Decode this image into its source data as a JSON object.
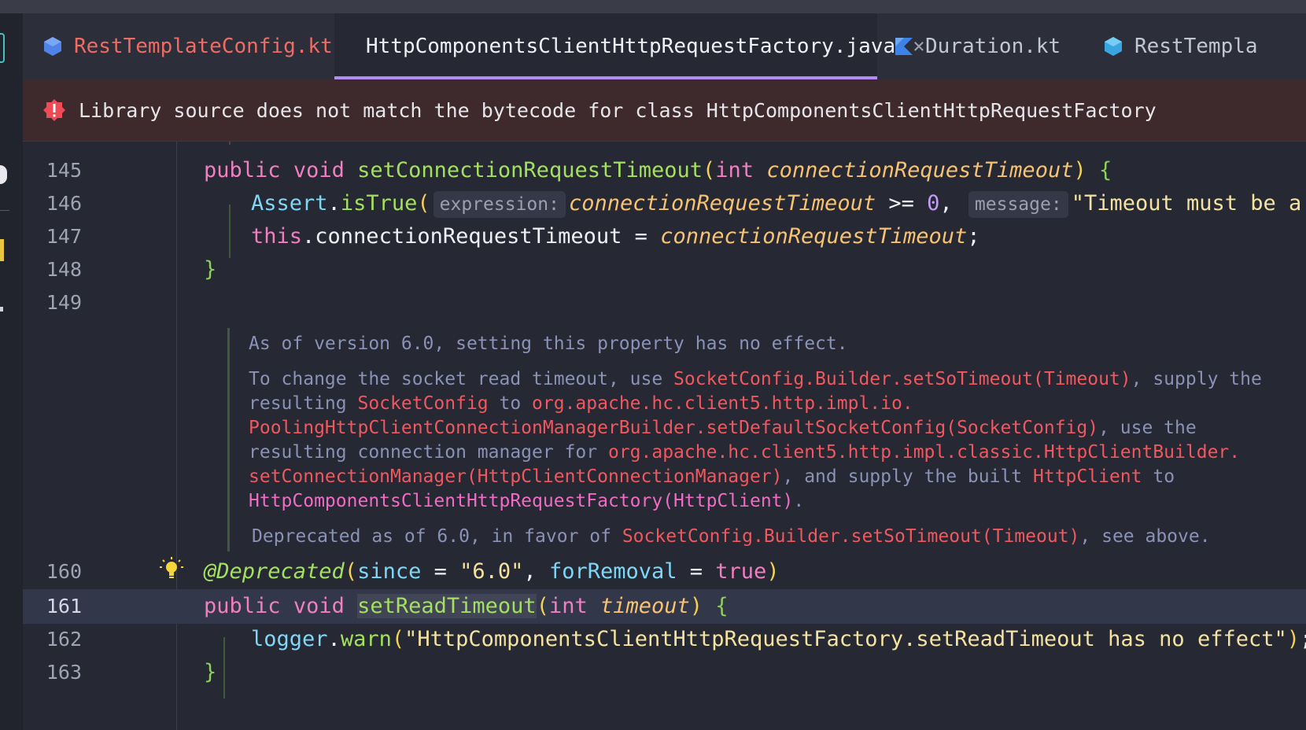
{
  "tabs": [
    {
      "label": "RestTemplateConfig.kt",
      "icon": "java-class-icon",
      "active": false
    },
    {
      "label": "HttpComponentsClientHttpRequestFactory.java",
      "icon": "java-class-icon",
      "active": true,
      "close": "×"
    },
    {
      "label": "Duration.kt",
      "icon": "kotlin-file-icon",
      "active": false
    },
    {
      "label": "RestTempla",
      "icon": "java-class-icon",
      "active": false
    }
  ],
  "banner": {
    "icon": "error-icon",
    "message": "Library source does not match the bytecode for class HttpComponentsClientHttpRequestFactory"
  },
  "editor": {
    "line_numbers": [
      "145",
      "146",
      "147",
      "148",
      "149",
      "160",
      "161",
      "162",
      "163"
    ],
    "current_line": "161",
    "line145": {
      "kw1": "public",
      "kw2": "void",
      "name": "setConnectionRequestTimeout",
      "open": "(",
      "type": "int",
      "param": "connectionRequestTimeout",
      "close": ")",
      "brace": "{"
    },
    "line146": {
      "cls": "Assert",
      "dot": ".",
      "method": "isTrue",
      "open": "(",
      "hint1": "expression:",
      "param": "connectionRequestTimeout",
      "op": " >= ",
      "num": "0",
      "comma": ",",
      "hint2": "message:",
      "str": "\"Timeout must be a non-"
    },
    "line147": {
      "kw": "this",
      "field": ".connectionRequestTimeout = ",
      "param": "connectionRequestTimeout",
      "end": ";"
    },
    "line148": {
      "brace": "}"
    },
    "line160": {
      "anno": "@Deprecated",
      "open": "(",
      "k1": "since",
      "eq1": " = ",
      "v1": "\"6.0\"",
      "comma": ", ",
      "k2": "forRemoval",
      "eq2": " = ",
      "v2": "true",
      "close": ")"
    },
    "line161": {
      "kw1": "public",
      "kw2": "void",
      "name": "setReadTimeout",
      "open": "(",
      "type": "int",
      "param": "timeout",
      "close": ")",
      "brace": "{"
    },
    "line162": {
      "obj": "logger",
      "dot": ".",
      "method": "warn",
      "open": "(",
      "str": "\"HttpComponentsClientHttpRequestFactory.setReadTimeout has no effect\"",
      "close": ")",
      "end": ";"
    },
    "line163": {
      "brace": "}"
    }
  },
  "doc": {
    "p1": "As of version 6.0, setting this property has no effect.",
    "p2_a": "To change the socket read timeout, use ",
    "p2_ref1": "SocketConfig.Builder.setSoTimeout(Timeout)",
    "p2_b": ", supply the",
    "p2_c": "resulting ",
    "p2_ref2": "SocketConfig",
    "p2_d": " to ",
    "p2_ref3": "org.apache.hc.client5.http.impl.io.",
    "p2_ref4": "PoolingHttpClientConnectionManagerBuilder.setDefaultSocketConfig(SocketConfig)",
    "p2_e": ", use the",
    "p2_f": "resulting connection manager for ",
    "p2_ref5": "org.apache.hc.client5.http.impl.classic.HttpClientBuilder.",
    "p2_ref6": "setConnectionManager(HttpClientConnectionManager)",
    "p2_g": ", and supply the built ",
    "p2_ref7": "HttpClient",
    "p2_h": " to",
    "p2_ref8": "HttpComponentsClientHttpRequestFactory(HttpClient)",
    "p2_i": ".",
    "p3_a": "Deprecated as of 6.0, in favor of ",
    "p3_ref": "SocketConfig.Builder.setSoTimeout(Timeout)",
    "p3_b": ", see above."
  },
  "icons": {
    "bulb": "lightbulb-icon"
  },
  "colors": {
    "accent": "#b48bf2",
    "error": "#f0585f",
    "banner_bg": "#3e2a2c"
  }
}
